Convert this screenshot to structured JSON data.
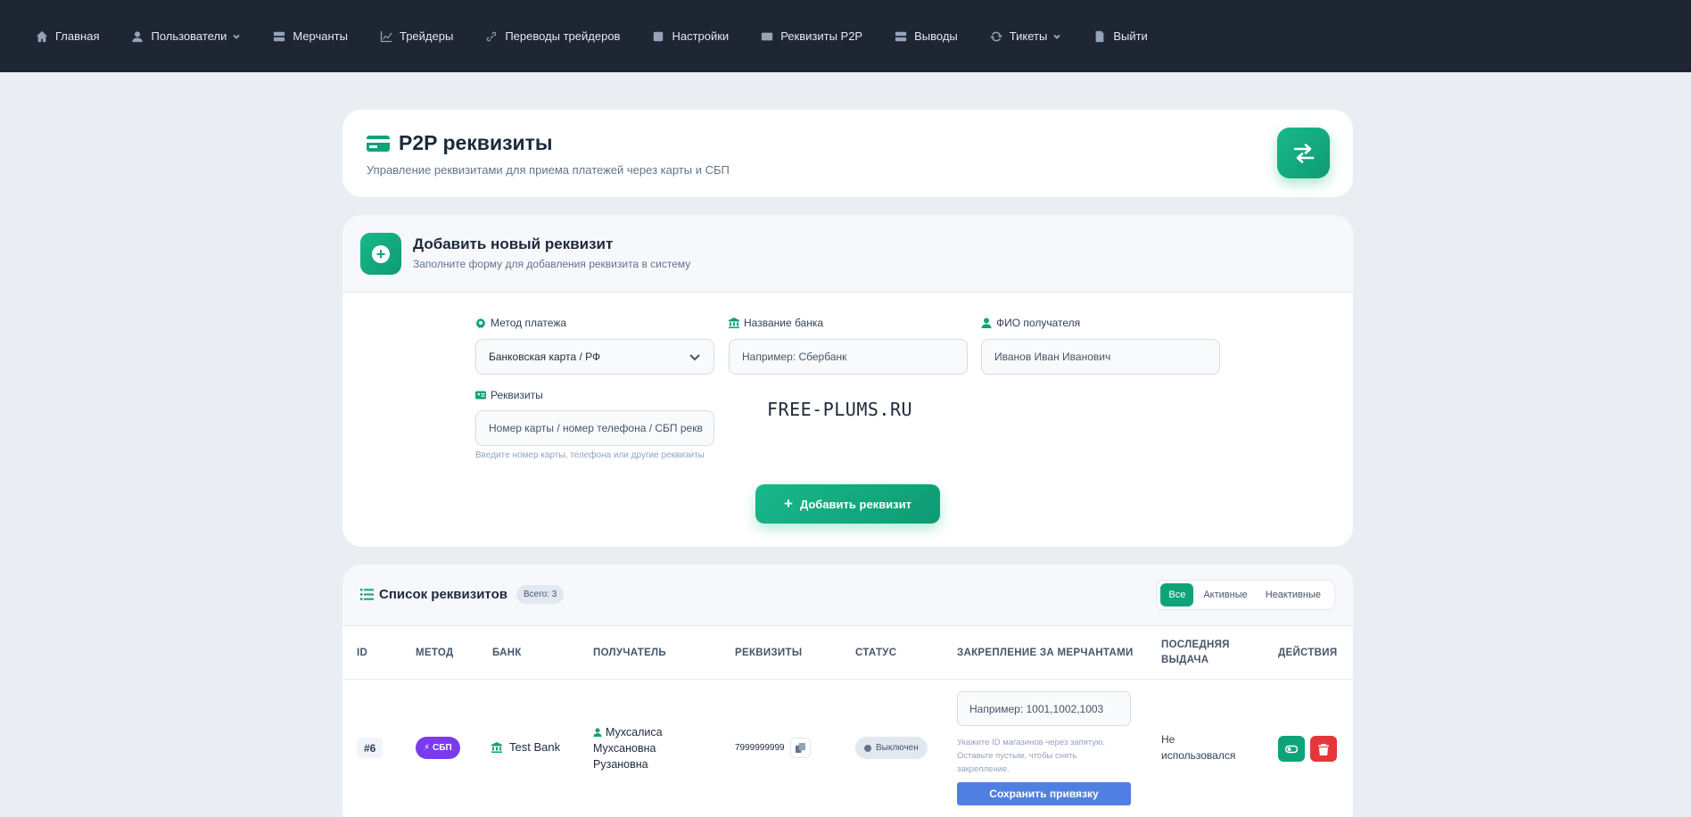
{
  "nav": {
    "items": [
      {
        "label": "Главная",
        "icon": "home-icon"
      },
      {
        "label": "Пользователи",
        "icon": "user-icon",
        "dropdown": true
      },
      {
        "label": "Мерчанты",
        "icon": "server-icon"
      },
      {
        "label": "Трейдеры",
        "icon": "chart-line-icon"
      },
      {
        "label": "Переводы трейдеров",
        "icon": "link-icon"
      },
      {
        "label": "Настройки",
        "icon": "settings-icon"
      },
      {
        "label": "Реквизиты P2P",
        "icon": "credit-card-icon"
      },
      {
        "label": "Выводы",
        "icon": "server-icon"
      },
      {
        "label": "Тикеты",
        "icon": "refresh-icon",
        "dropdown": true
      },
      {
        "label": "Выйти",
        "icon": "door-icon"
      }
    ]
  },
  "header": {
    "title": "P2P реквизиты",
    "subtitle": "Управление реквизитами для приема платежей через карты и СБП"
  },
  "add_form": {
    "title": "Добавить новый реквизит",
    "subtitle": "Заполните форму для добавления реквизита в систему",
    "method_label": "Метод платежа",
    "method_value": "Банковская карта / РФ",
    "bank_label": "Название банка",
    "bank_placeholder": "Например: Сбербанк",
    "recipient_label": "ФИО получателя",
    "recipient_placeholder": "Иванов Иван Иванович",
    "requisites_label": "Реквизиты",
    "requisites_placeholder": "Номер карты / номер телефона / СБП рекв",
    "requisites_hint": "Введите номер карты, телефона или другие реквизиты",
    "watermark": "FREE-PLUMS.RU",
    "submit_label": "Добавить реквизит"
  },
  "list": {
    "title": "Список реквизитов",
    "count": "Всего: 3",
    "filters": [
      "Все",
      "Активные",
      "Неактивные"
    ],
    "active_filter": "Все",
    "columns": {
      "id": "ID",
      "method": "Метод",
      "bank": "Банк",
      "recipient": "Получатель",
      "requisites": "Реквизиты",
      "status": "Статус",
      "merchants": "Закрепление за мерчантами",
      "last_used": "Последняя выдача",
      "actions": "Действия"
    },
    "rows": [
      {
        "id": "#6",
        "method": "СБП",
        "bank": "Test Bank",
        "recipient": "Мухсалиса Мухсановна Рузановна",
        "requisites": "7999999999",
        "status": "Выключен",
        "merchant_placeholder": "Например: 1001,1002,1003",
        "merchant_hint": "Укажите ID магазинов через запятую. Оставьте пустым, чтобы снять закрепление.",
        "save_label": "Сохранить привязку",
        "last_used": "Не использовался"
      }
    ]
  },
  "colors": {
    "navbar": "#1e2633",
    "accent": "#10a37a",
    "method_badge": "#7c3aed",
    "save_button": "#4f7fe0",
    "delete_button": "#e5363b"
  }
}
